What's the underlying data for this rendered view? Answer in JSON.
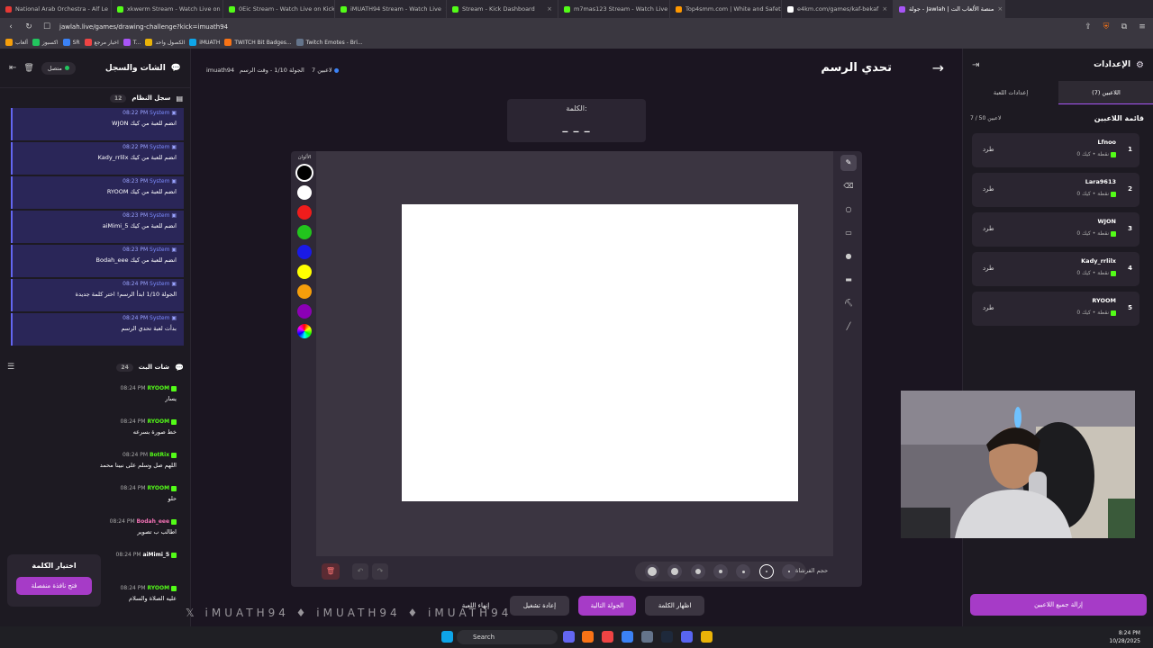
{
  "browser": {
    "tabs": [
      {
        "label": "National Arab Orchestra - Alf Le",
        "color": "#e53935"
      },
      {
        "label": "xkwerm Stream - Watch Live on",
        "color": "#53fc18"
      },
      {
        "label": "0Eic Stream - Watch Live on Kick",
        "color": "#53fc18"
      },
      {
        "label": "iMUATH94 Stream - Watch Live",
        "color": "#53fc18"
      },
      {
        "label": "Stream - Kick Dashboard",
        "color": "#53fc18"
      },
      {
        "label": "m7mas123 Stream - Watch Live on",
        "color": "#53fc18"
      },
      {
        "label": "Top4smm.com | White and Safety Pr",
        "color": "#ff9800"
      },
      {
        "label": "e4km.com/games/kaf-bekaf",
        "color": "#ffffff"
      },
      {
        "label": "جولة - Jawlah | منصة الألعاب الت",
        "color": "#a855f7"
      }
    ],
    "url": "jawlah.live/games/drawing-challenge?kick=imuath94",
    "bookmarks": [
      "ألعاب",
      "اكسبوز",
      "SR",
      "اخبار مرجع",
      "T...",
      "الكصول واحد",
      "iMUATH",
      "TWITCH Bit Badges...",
      "Twitch Emotes - Bri..."
    ]
  },
  "left_panel": {
    "title": "الشات والسجل",
    "status": "متصل",
    "system_log": {
      "title": "سجل النظام",
      "count": "12",
      "messages": [
        {
          "time": "08:22 PM",
          "sender": "System",
          "text": "WJON انضم للعبة من كيك"
        },
        {
          "time": "08:22 PM",
          "sender": "System",
          "text": "Kady_rrlilx انضم للعبة من كيك"
        },
        {
          "time": "08:23 PM",
          "sender": "System",
          "text": "RYOOM انضم للعبة من كيك"
        },
        {
          "time": "08:23 PM",
          "sender": "System",
          "text": "aiMimi_5 انضم للعبة من كيك"
        },
        {
          "time": "08:23 PM",
          "sender": "System",
          "text": "Bodah_eee انضم للعبة من كيك"
        },
        {
          "time": "08:24 PM",
          "sender": "System",
          "text": "الجولة 1/10 ابدأ الرسم! اختر كلمة جديدة"
        },
        {
          "time": "08:24 PM",
          "sender": "System",
          "text": "بدأت لعبة تحدي الرسم"
        }
      ]
    },
    "live_chat": {
      "title": "شات البث",
      "count": "24",
      "messages": [
        {
          "time": "08:24 PM",
          "user": "RYOOM",
          "user_color": "#53fc18",
          "text": "يسار"
        },
        {
          "time": "08:24 PM",
          "user": "RYOOM",
          "user_color": "#53fc18",
          "text": "خط صورة بسرعه"
        },
        {
          "time": "08:24 PM",
          "user": "BotRix",
          "user_color": "#53fc18",
          "text": "اللهم صل وسلم على نبينا محمد"
        },
        {
          "time": "08:24 PM",
          "user": "RYOOM",
          "user_color": "#53fc18",
          "text": "حلو"
        },
        {
          "time": "08:24 PM",
          "user": "Bodah_eee",
          "user_color": "#f472b6",
          "text": "اطالب ب تصوير"
        },
        {
          "time": "08:24 PM",
          "user": "aiMimi_5",
          "user_color": "#ffffff",
          "text": ""
        },
        {
          "time": "08:24 PM",
          "user": "RYOOM",
          "user_color": "#53fc18",
          "text": "عليه الصلاة والسلام"
        }
      ]
    },
    "word_choice": {
      "title": "اختيار الكلمة",
      "button": "فتح نافذة منفصلة"
    }
  },
  "center": {
    "players_count": "7 لاعبين",
    "round_info": "الجولة 1/10 - وقت الرسم",
    "author": "imuath94",
    "game_title": "تحدي الرسم",
    "word_label": "الكلمة:",
    "word_hidden": "_ _ _",
    "colors_label": "الألوان",
    "colors": [
      "#000000",
      "#ffffff",
      "#ef1c1c",
      "#22c51d",
      "#1a1ae6",
      "#ffff00",
      "#f59e0b",
      "#8b00b5"
    ],
    "brush_size_label": "حجم الفرشاة",
    "actions": {
      "end_game": "إنهاء اللعبة",
      "restart": "إعادة تشغيل",
      "next_round": "الجولة التالية",
      "show_word": "اظهار الكلمة"
    }
  },
  "right_panel": {
    "title": "الإعدادات",
    "tabs": [
      "اللاعبين (7)",
      "إعدادات اللعبة"
    ],
    "list_title": "قائمة اللاعبين",
    "list_count": "7 / 50 لاعبين",
    "players": [
      {
        "rank": "1",
        "name": "Lfnoo",
        "points": "0 نقطة",
        "source": "كيك",
        "kick_label": "طرد"
      },
      {
        "rank": "2",
        "name": "Lara9613",
        "points": "0 نقطة",
        "source": "كيك",
        "kick_label": "طرد"
      },
      {
        "rank": "3",
        "name": "WJON",
        "points": "0 نقطة",
        "source": "كيك",
        "kick_label": "طرد"
      },
      {
        "rank": "4",
        "name": "Kady_rrlilx",
        "points": "0 نقطة",
        "source": "كيك",
        "kick_label": "طرد"
      },
      {
        "rank": "5",
        "name": "RYOOM",
        "points": "0 نقطة",
        "source": "كيك",
        "kick_label": "طرد"
      }
    ],
    "remove_all": "إزالة جميع اللاعبين"
  },
  "overlay_text": "iMUATH94 ♦ iMUATH94 ♦ iMUATH94",
  "taskbar": {
    "search_placeholder": "Search",
    "time": "8:24 PM",
    "date": "10/28/2025"
  }
}
